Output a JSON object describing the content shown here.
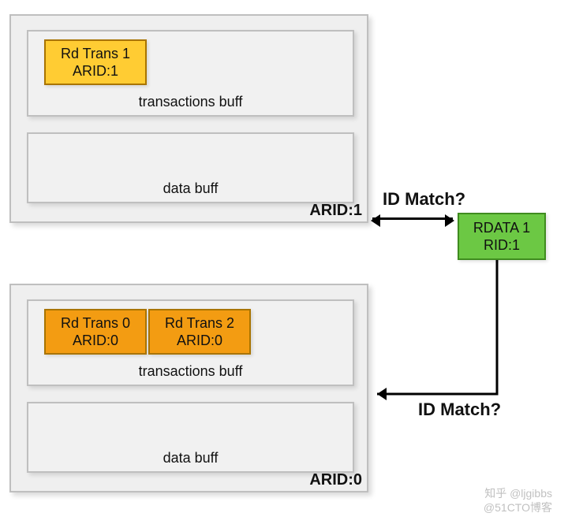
{
  "groups": [
    {
      "arid_label": "ARID:1",
      "trans_buff_label": "transactions buff",
      "data_buff_label": "data buff",
      "trans": [
        {
          "line1": "Rd Trans 1",
          "line2": "ARID:1"
        }
      ]
    },
    {
      "arid_label": "ARID:0",
      "trans_buff_label": "transactions buff",
      "data_buff_label": "data buff",
      "trans": [
        {
          "line1": "Rd Trans 0",
          "line2": "ARID:0"
        },
        {
          "line1": "Rd Trans 2",
          "line2": "ARID:0"
        }
      ]
    }
  ],
  "rdata": {
    "line1": "RDATA 1",
    "line2": "RID:1"
  },
  "match_label_top": "ID Match?",
  "match_label_bottom": "ID Match?",
  "watermark": {
    "l1": "知乎 @ljgibbs",
    "l2": "@51CTO博客"
  }
}
